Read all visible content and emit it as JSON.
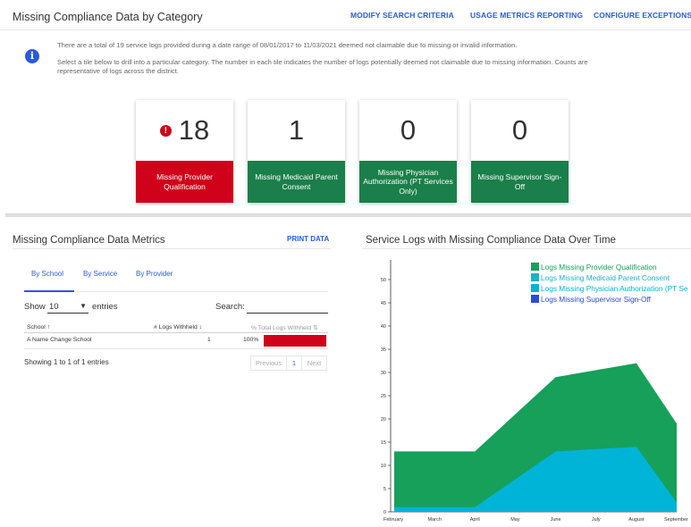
{
  "header": {
    "title": "Missing Compliance Data by Category",
    "links": [
      {
        "label": "MODIFY SEARCH CRITERIA"
      },
      {
        "label": "USAGE METRICS REPORTING"
      },
      {
        "label": "CONFIGURE EXCEPTIONS"
      }
    ]
  },
  "info": {
    "icon": "info-icon",
    "line1": "There are a total of 19 service logs provided during a date range of 08/01/2017 to 11/03/2021 deemed not claimable due to missing or invalid information.",
    "line2": "Select a tile below to drill into a particular category. The number in each tile indicates the number of logs potentially deemed not claimable due to missing information. Counts are",
    "line3": "representative of logs across the district."
  },
  "tiles": [
    {
      "count": "18",
      "label": "Missing Provider Qualification",
      "color": "#d0021b",
      "alert": "!"
    },
    {
      "count": "1",
      "label": "Missing Medicaid Parent Consent",
      "color": "#1a7f4a"
    },
    {
      "count": "0",
      "label": "Missing Physician Authorization (PT Services Only)",
      "color": "#1a7f4a"
    },
    {
      "count": "0",
      "label": "Missing Supervisor Sign-Off",
      "color": "#1a7f4a"
    }
  ],
  "metrics": {
    "title": "Missing Compliance Data Metrics",
    "print_label": "PRINT DATA",
    "tabs": [
      {
        "label": "By School",
        "active": true
      },
      {
        "label": "By Service"
      },
      {
        "label": "By Provider"
      }
    ],
    "show_label": "Show",
    "entries_value": "10",
    "entries_label": "entries",
    "search_label": "Search:",
    "columns": [
      {
        "label": "School",
        "sort": "↑"
      },
      {
        "label": "# Logs Withheld",
        "sort": "↓"
      },
      {
        "label": "% Total Logs Withheld",
        "sort": "⇅"
      }
    ],
    "rows": [
      {
        "school": "A Name Change School",
        "withheld": "1",
        "pct": "100%",
        "pct_value": 100
      }
    ],
    "summary": "Showing 1 to 1 of 1 entries",
    "pager": {
      "previous": "Previous",
      "page": "1",
      "next": "Next"
    }
  },
  "chart_title": "Service Logs with Missing Compliance Data Over Time",
  "chart_data": {
    "type": "area",
    "x": [
      "February",
      "March",
      "April",
      "May",
      "June",
      "July",
      "August",
      "September"
    ],
    "ylim": [
      0,
      55
    ],
    "yticks": [
      "0",
      "5",
      "10",
      "15",
      "20",
      "25",
      "30",
      "35",
      "40",
      "45",
      "50"
    ],
    "series": [
      {
        "name": "Logs Missing Provider Qualification",
        "color": "#16a05a",
        "values": [
          13,
          13,
          13,
          21,
          29,
          30.5,
          32,
          19
        ]
      },
      {
        "name": "Logs Missing Medicaid Parent Consent",
        "color": "#1ab3c9",
        "values": [
          0,
          0,
          0,
          0,
          0,
          0,
          0,
          0
        ]
      },
      {
        "name": "Logs Missing Physician Authorization (PT Se",
        "color": "#00b4d8",
        "values": [
          1,
          1,
          1,
          7,
          13,
          13.5,
          14,
          2
        ]
      },
      {
        "name": "Logs Missing Supervisor Sign-Off",
        "color": "#2a4bd7",
        "values": [
          0,
          0,
          0,
          0,
          0,
          0,
          0,
          0
        ]
      }
    ],
    "legend": "top-right",
    "grid": false
  }
}
